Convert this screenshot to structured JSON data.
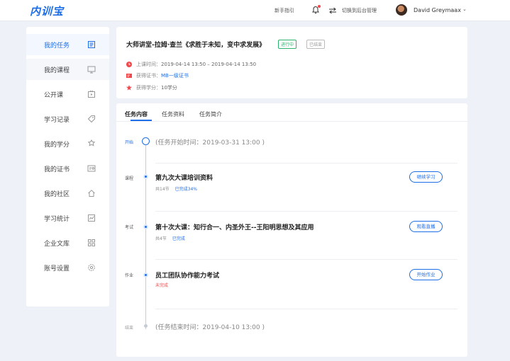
{
  "app": {
    "logo": "内训宝"
  },
  "topbar": {
    "guide": "新手指引",
    "switch_admin": "切换到后台管理",
    "username": "David Greymaax",
    "caret": "⌄"
  },
  "sidebar": {
    "items": [
      {
        "label": "我的任务",
        "icon": "list-icon"
      },
      {
        "label": "我的课程",
        "icon": "monitor-icon"
      },
      {
        "label": "公开课",
        "icon": "play-box-icon"
      },
      {
        "label": "学习记录",
        "icon": "tag-icon"
      },
      {
        "label": "我的学分",
        "icon": "badge-icon"
      },
      {
        "label": "我的证书",
        "icon": "certificate-icon"
      },
      {
        "label": "我的社区",
        "icon": "home-icon"
      },
      {
        "label": "学习统计",
        "icon": "chart-icon"
      },
      {
        "label": "企业文库",
        "icon": "grid-icon"
      },
      {
        "label": "账号设置",
        "icon": "gear-icon"
      }
    ]
  },
  "course": {
    "title": "大师讲堂-拉姆·查兰《求胜于未知，变中求发展》",
    "tag_progress": "进行中",
    "tag_ended": "已结束",
    "time_label": "上课时间：",
    "time_value": "2019-04-14 13:50 – 2019-04-14 13:50",
    "cert_label": "获得证书：",
    "cert_value": "MB一级证书",
    "credit_label": "获得学分：",
    "credit_value": "10学分"
  },
  "tabs": [
    "任务内容",
    "任务资料",
    "任务简介"
  ],
  "timeline": {
    "start_label": "开始",
    "start_time": "(任务开始时间：2019-03-31 13:00 )",
    "end_label": "结束",
    "end_time": "(任务结束时间：2019-04-10 13:00 )",
    "tasks": [
      {
        "type": "课程",
        "title": "第九次大课培训资料",
        "meta": "共14节",
        "status": "已完成34%",
        "button": "继续学习"
      },
      {
        "type": "考试",
        "title": "第十次大课：知行合一、内圣外王--王阳明思想及其应用",
        "meta": "共4节",
        "status": "已完成",
        "button": "观看直播"
      },
      {
        "type": "作业",
        "title": "员工团队协作能力考试",
        "meta": "",
        "status": "未完成",
        "button": "开始作业"
      }
    ]
  },
  "colors": {
    "accent": "#1e6ee8",
    "success": "#2fb26b",
    "danger": "#f0484b"
  }
}
